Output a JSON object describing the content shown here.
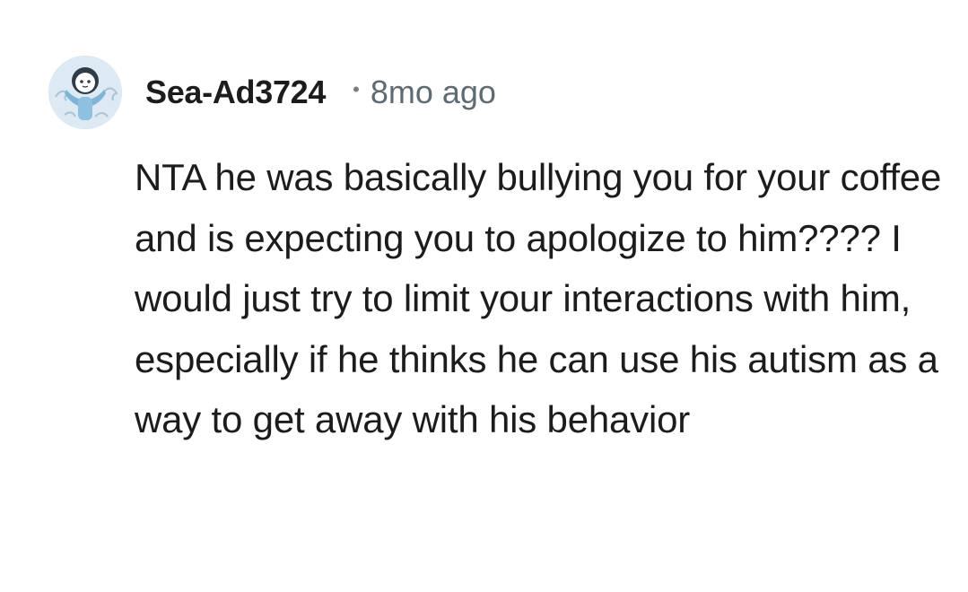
{
  "comment": {
    "author": "Sea-Ad3724",
    "separator": "•",
    "timestamp": "8mo ago",
    "avatar_icon": "snoo-avatar-icon",
    "body": "NTA he was basically bullying you for your coffee and is expecting you to apologize to him???? I would just try to limit your interactions with him, especially if he thinks he can use his autism as a way to get away with his behavior"
  },
  "colors": {
    "background": "#ffffff",
    "text": "#1c1c1c",
    "meta": "#5f6b73",
    "avatar_bg": "#dde9f3"
  }
}
